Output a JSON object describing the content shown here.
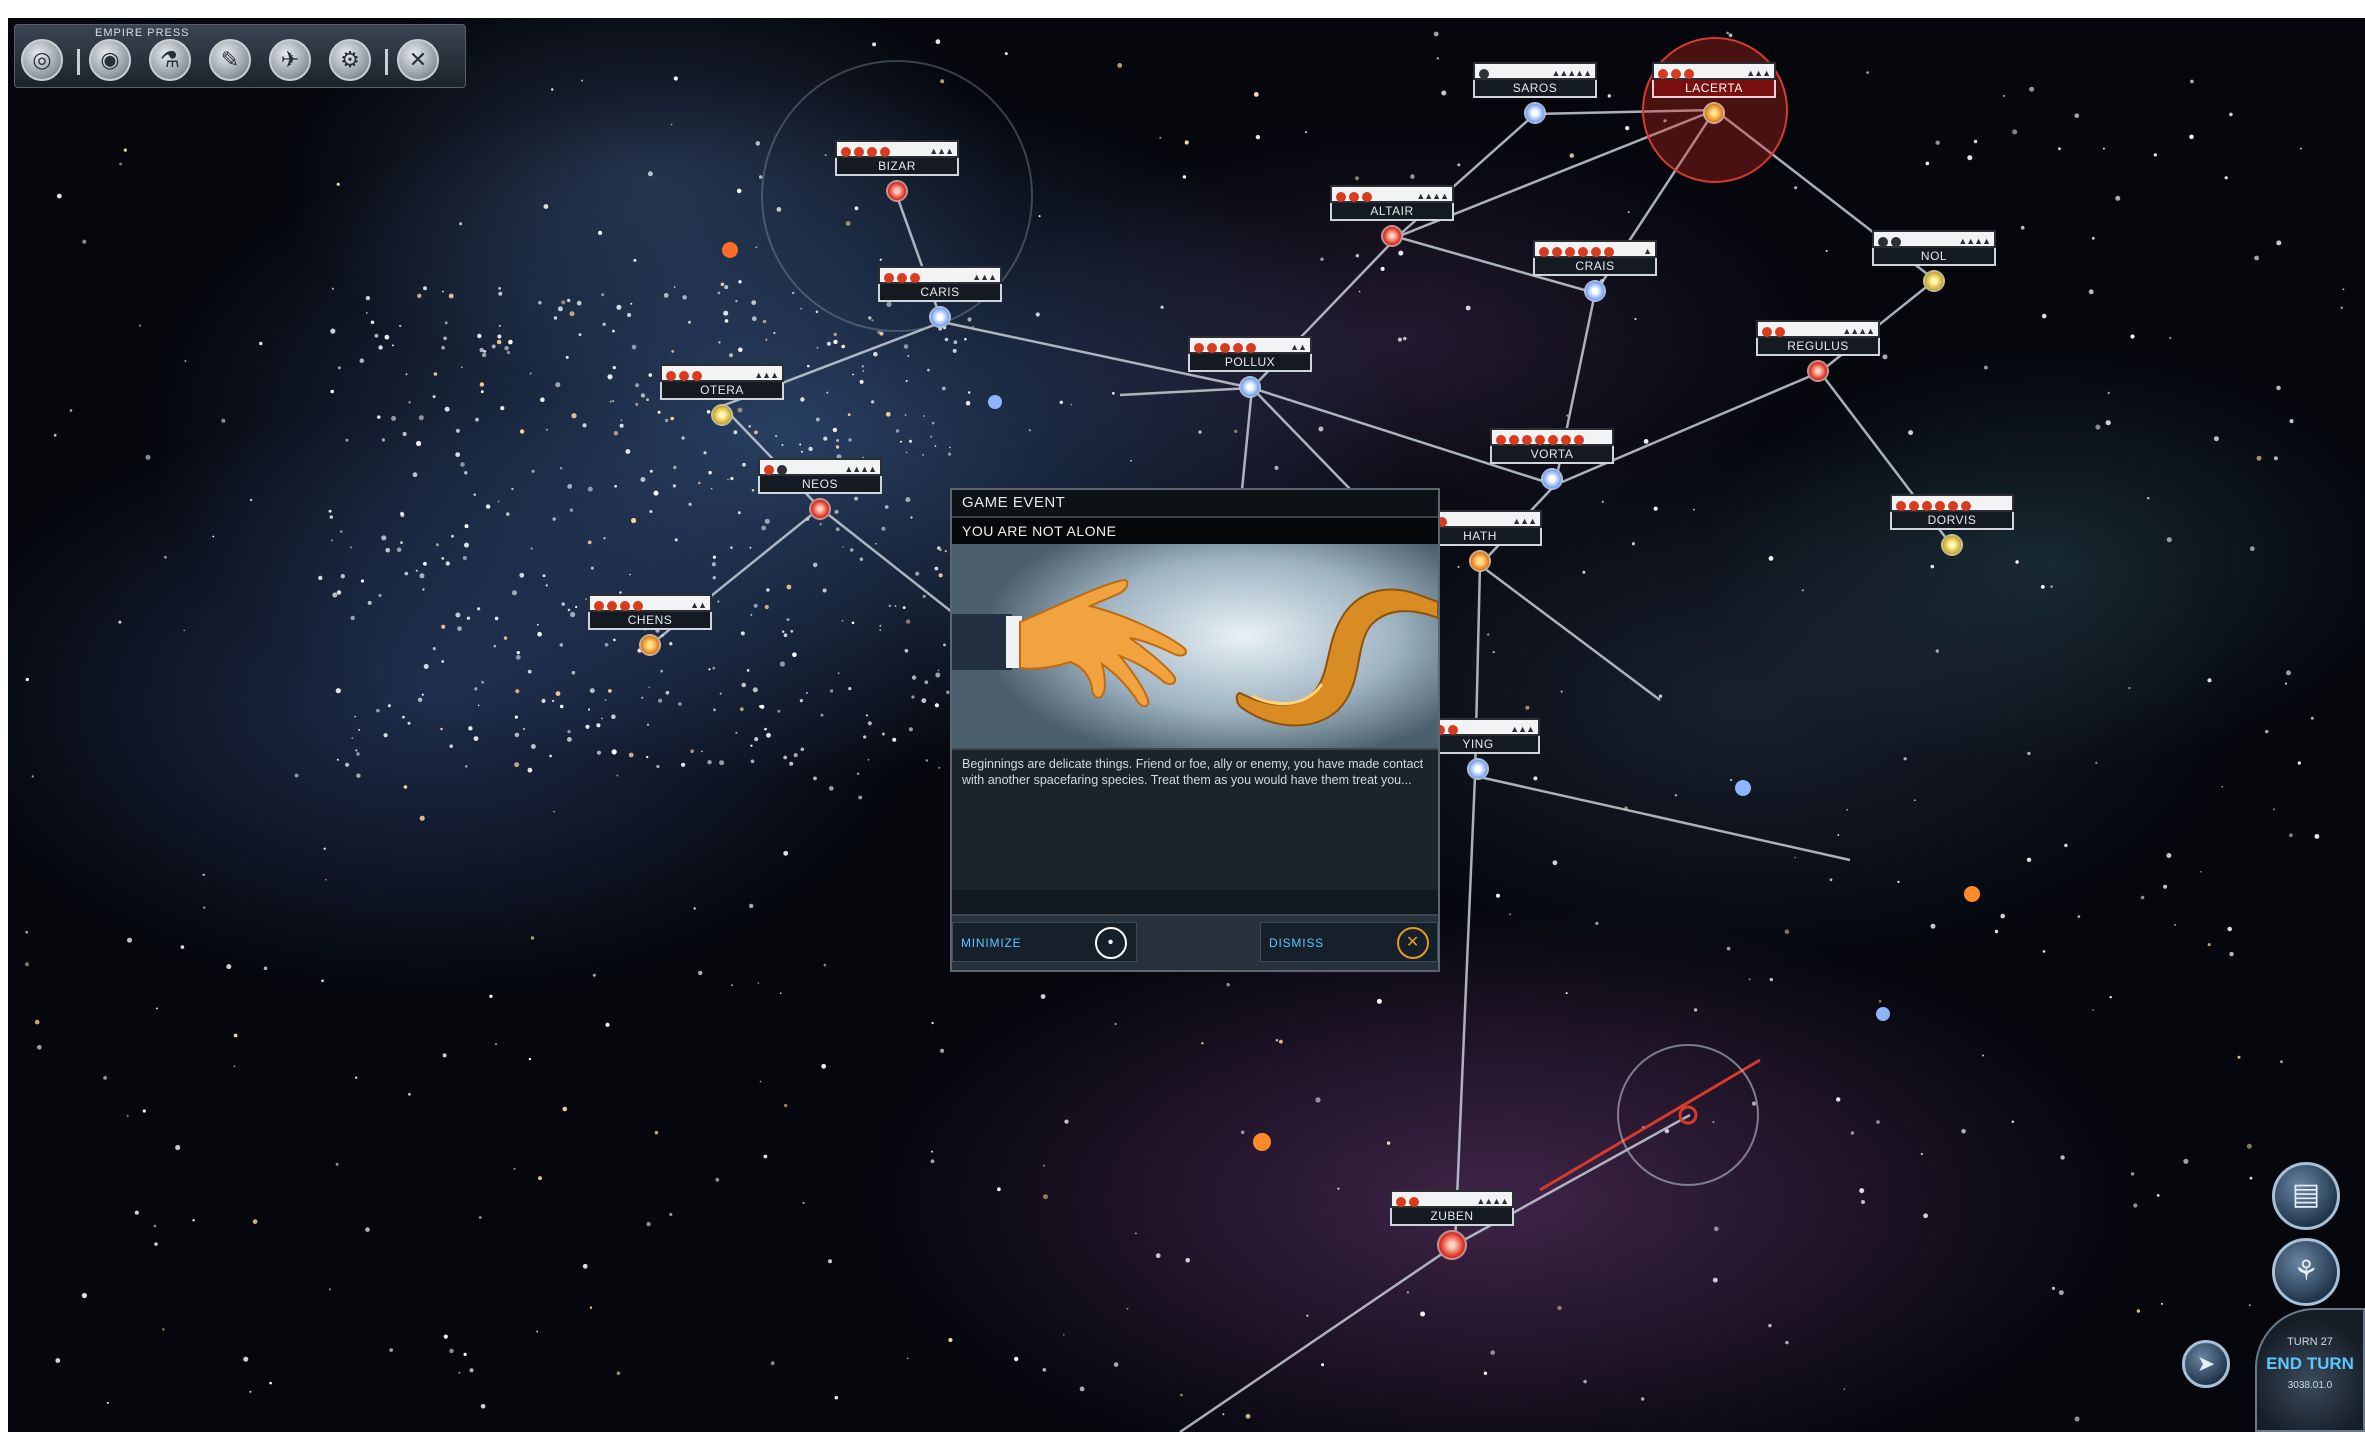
{
  "toolbar": {
    "label": "EMPIRE PRESS",
    "buttons": [
      {
        "icon": "galaxy-icon"
      },
      {
        "icon": "planets-icon"
      },
      {
        "icon": "research-icon"
      },
      {
        "icon": "diplomacy-icon"
      },
      {
        "icon": "fleet-icon"
      },
      {
        "icon": "tech-icon"
      },
      {
        "icon": "close-icon"
      }
    ]
  },
  "systems": [
    {
      "name": "BIZAR"
    },
    {
      "name": "CARIS"
    },
    {
      "name": "OTERA"
    },
    {
      "name": "NEOS"
    },
    {
      "name": "CHENS"
    },
    {
      "name": "POLLUX"
    },
    {
      "name": "ALTAIR"
    },
    {
      "name": "SAROS"
    },
    {
      "name": "LACERTA"
    },
    {
      "name": "CRAIS"
    },
    {
      "name": "NOL"
    },
    {
      "name": "REGULUS"
    },
    {
      "name": "VORTA"
    },
    {
      "name": "HATH"
    },
    {
      "name": "DORVIS"
    },
    {
      "name": "YING"
    },
    {
      "name": "ZUBEN"
    }
  ],
  "event": {
    "header": "GAME EVENT",
    "title": "YOU ARE NOT ALONE",
    "body": "Beginnings are delicate things. Friend or foe, ally or enemy, you have made contact with another spacefaring species. Treat them as you would have them treat you...",
    "minimize_label": "MINIMIZE",
    "dismiss_label": "DISMISS"
  },
  "hud": {
    "encyclopedia_icon": "book-icon",
    "diplomacy_icon": "handshake-icon",
    "turn_label": "TURN 27",
    "end_turn_label": "END TURN",
    "date_label": "3038.01.0",
    "fleet_icon": "fleet-icon"
  },
  "colors": {
    "enemy": "#c8281e",
    "lane": "#c7ced6",
    "accent_blue": "#5cc6ff",
    "dismiss_orange": "#e49a1e"
  }
}
